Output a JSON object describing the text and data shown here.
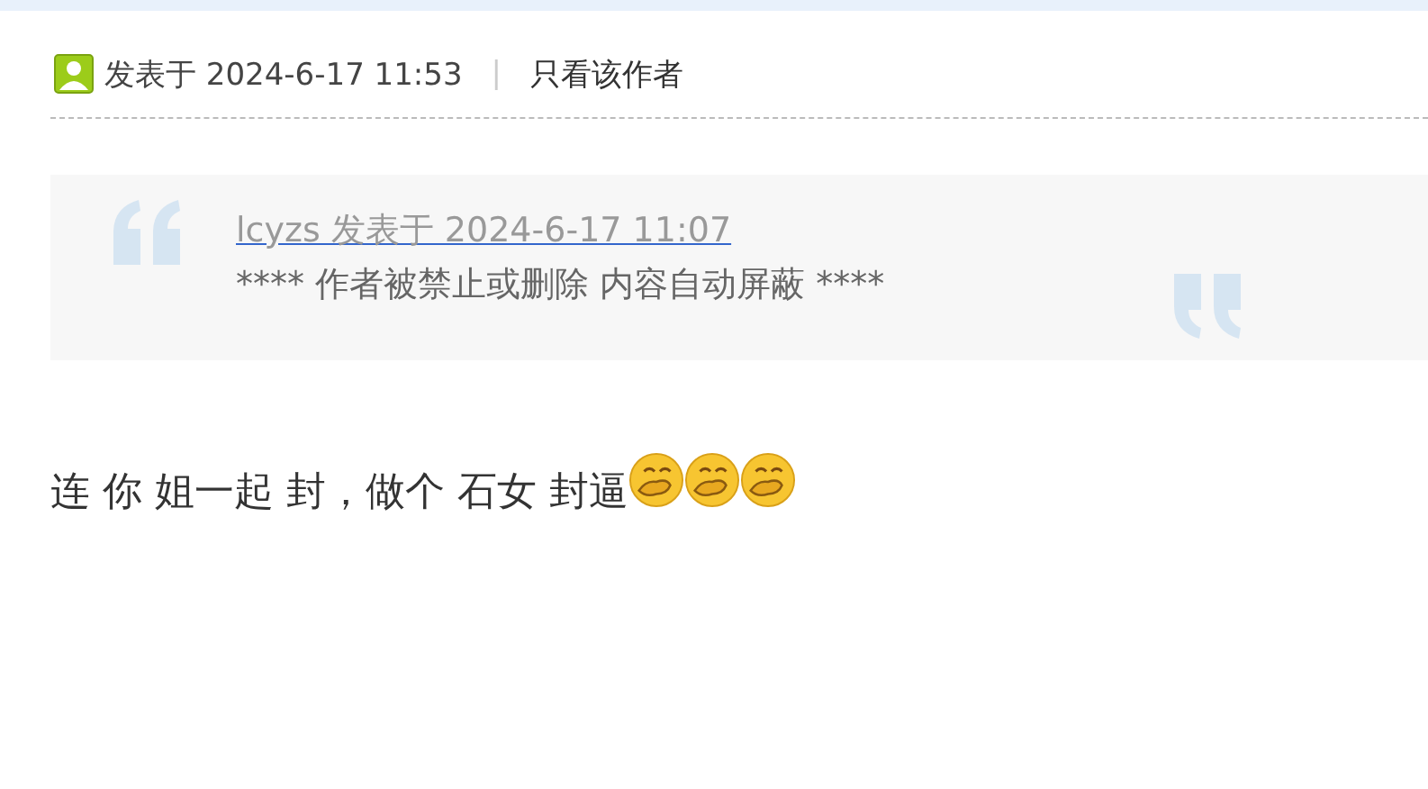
{
  "post_header": {
    "posted_label": "发表于 2024-6-17 11:53",
    "separator": "|",
    "author_only_link": "只看该作者"
  },
  "quote": {
    "source_link": "lcyzs 发表于 2024-6-17 11:07",
    "text": "**** 作者被禁止或删除 内容自动屏蔽 ****"
  },
  "post_body": {
    "text": "连 你 姐一起 封，做个  石女 封逼",
    "emojis": [
      {
        "kind": "giggle"
      },
      {
        "kind": "giggle"
      },
      {
        "kind": "giggle"
      }
    ]
  }
}
